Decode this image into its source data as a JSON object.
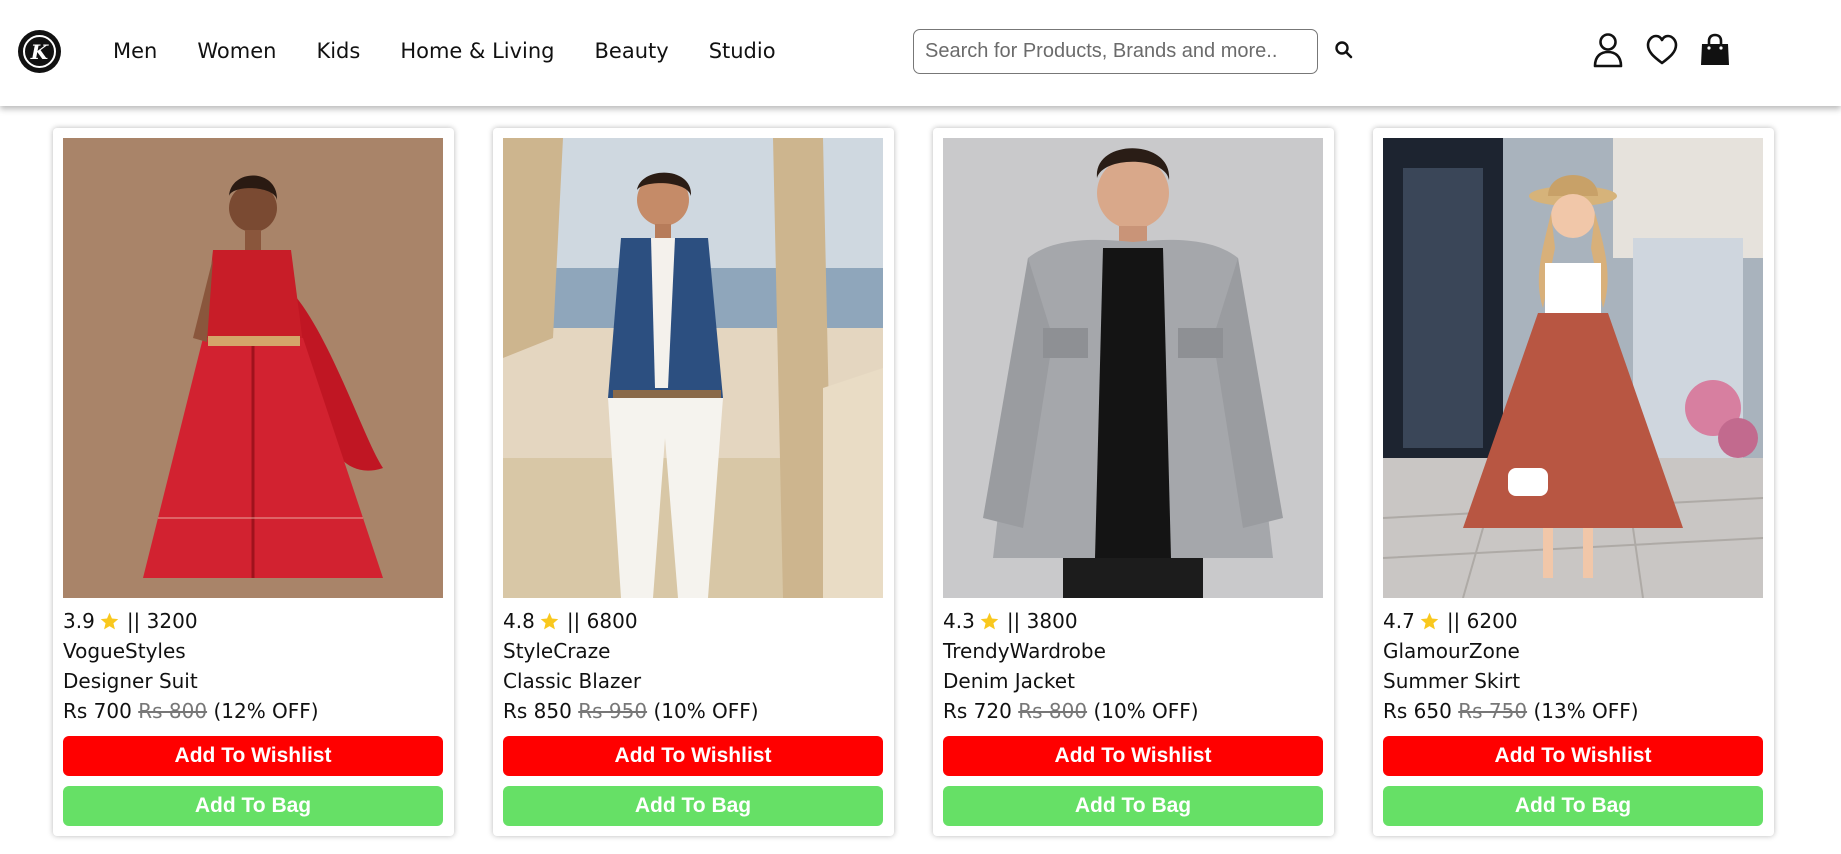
{
  "header": {
    "logo_letter": "K",
    "nav": [
      "Men",
      "Women",
      "Kids",
      "Home & Living",
      "Beauty",
      "Studio"
    ],
    "search_placeholder": "Search for Products, Brands and more..",
    "icons": [
      "search-icon",
      "user-icon",
      "heart-icon",
      "bag-icon"
    ]
  },
  "products": [
    {
      "rating": "3.9",
      "separator": "||",
      "reviews": "3200",
      "brand": "VogueStyles",
      "name": "Designer Suit",
      "price": "Rs 700",
      "original_price": "Rs 800",
      "discount": "(12% OFF)",
      "wishlist_label": "Add To Wishlist",
      "bag_label": "Add To Bag"
    },
    {
      "rating": "4.8",
      "separator": "||",
      "reviews": "6800",
      "brand": "StyleCraze",
      "name": "Classic Blazer",
      "price": "Rs 850",
      "original_price": "Rs 950",
      "discount": "(10% OFF)",
      "wishlist_label": "Add To Wishlist",
      "bag_label": "Add To Bag"
    },
    {
      "rating": "4.3",
      "separator": "||",
      "reviews": "3800",
      "brand": "TrendyWardrobe",
      "name": "Denim Jacket",
      "price": "Rs 720",
      "original_price": "Rs 800",
      "discount": "(10% OFF)",
      "wishlist_label": "Add To Wishlist",
      "bag_label": "Add To Bag"
    },
    {
      "rating": "4.7",
      "separator": "||",
      "reviews": "6200",
      "brand": "GlamourZone",
      "name": "Summer Skirt",
      "price": "Rs 650",
      "original_price": "Rs 750",
      "discount": "(13% OFF)",
      "wishlist_label": "Add To Wishlist",
      "bag_label": "Add To Bag"
    }
  ],
  "colors": {
    "wishlist": "#ff0000",
    "bag": "#66e066",
    "star": "#f9c81e",
    "text": "#111111"
  }
}
